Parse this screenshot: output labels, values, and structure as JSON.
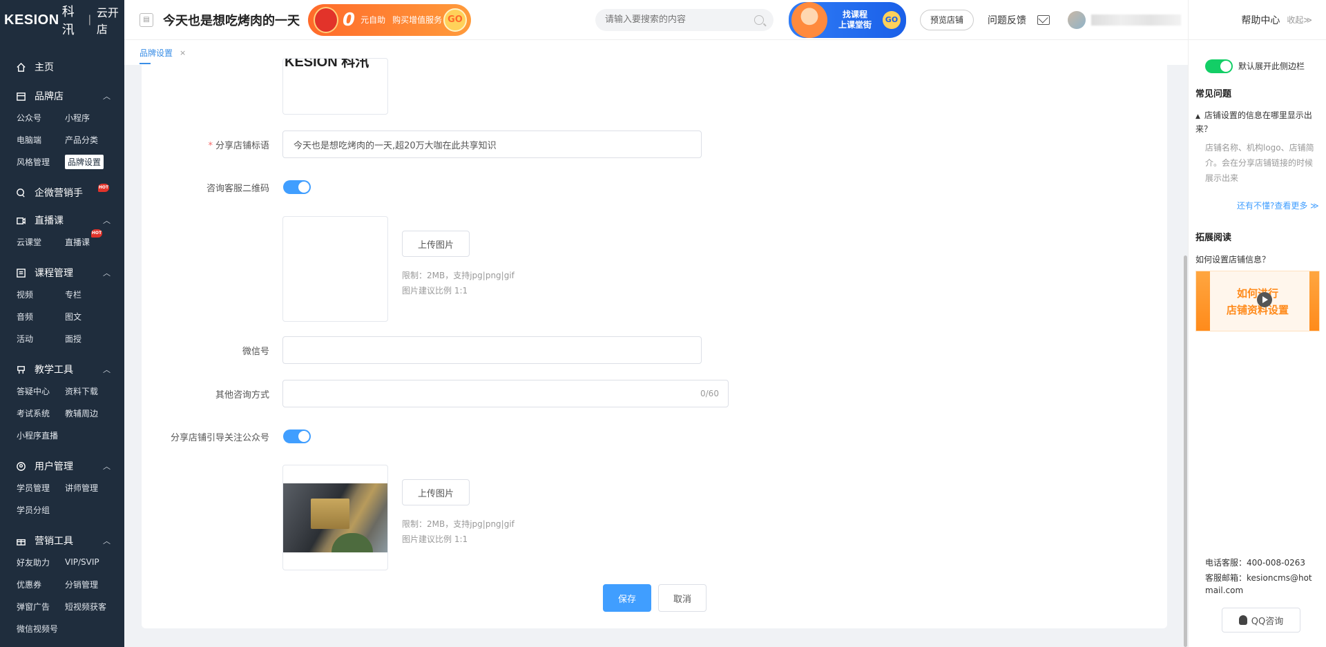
{
  "sidebar": {
    "brand": "KESION",
    "brand_cn": "科汛",
    "sep": "|",
    "sub": "云开店",
    "home": "主页",
    "groups": [
      {
        "label": "品牌店",
        "items": [
          "公众号",
          "小程序",
          "电脑端",
          "产品分类",
          "风格管理",
          "品牌设置"
        ]
      },
      {
        "label": "企微营销手",
        "hot": "HOT"
      },
      {
        "label": "直播课",
        "items": [
          "云课堂",
          "直播课"
        ],
        "hot": "HOT"
      },
      {
        "label": "课程管理",
        "items": [
          "视频",
          "专栏",
          "音频",
          "图文",
          "活动",
          "面授"
        ]
      },
      {
        "label": "教学工具",
        "items": [
          "答疑中心",
          "资料下载",
          "考试系统",
          "教辅周边",
          "小程序直播"
        ]
      },
      {
        "label": "用户管理",
        "items": [
          "学员管理",
          "讲师管理",
          "学员分组"
        ]
      },
      {
        "label": "营销工具",
        "items": [
          "好友助力",
          "VIP/SVIP",
          "优惠券",
          "分销管理",
          "弹窗广告",
          "短视频获客",
          "微信视频号"
        ]
      }
    ],
    "active_item": "品牌设置"
  },
  "topbar": {
    "store_name": "今天也是想吃烤肉的一天",
    "promo": {
      "zero": "0",
      "t1": "元自助",
      "t2": "购买增值服务",
      "go": "GO"
    },
    "search_placeholder": "请输入要搜索的内容",
    "banner2": {
      "line1": "找课程",
      "line2": "上课堂街",
      "go": "GO"
    },
    "preview": "预览店铺",
    "feedback": "问题反馈"
  },
  "tabs": [
    {
      "label": "品牌设置",
      "close": "×"
    }
  ],
  "form": {
    "share_title_label": "分享店铺标语",
    "share_title_value": "今天也是想吃烤肉的一天,超20万大咖在此共享知识",
    "qrcode_label": "咨询客服二维码",
    "upload_label": "上传图片",
    "hint_size": "限制：2MB，支持jpg|png|gif",
    "hint_ratio": "图片建议比例 1:1",
    "wechat_label": "微信号",
    "wechat_value": "",
    "other_label": "其他咨询方式",
    "other_value": "",
    "other_counter": "0/60",
    "follow_label": "分享店铺引导关注公众号",
    "logo_fragment": "KESION 科汛",
    "save": "保存",
    "cancel": "取消"
  },
  "help": {
    "title": "帮助中心",
    "collapse": "收起≫",
    "default_open": "默认展开此侧边栏",
    "faq_title": "常见问题",
    "faq_q": "店铺设置的信息在哪里显示出来？",
    "faq_a": "店铺名称、机构logo、店铺简介。会在分享店铺链接的时候展示出来",
    "more": "还有不懂?查看更多 ≫",
    "ext_title": "拓展阅读",
    "ext_q": "如何设置店铺信息？",
    "video_l1": "如何进行",
    "video_l2": "店铺资料设置",
    "phone": "电话客服：400-008-0263",
    "email": "客服邮箱：kesioncms@hotmail.com",
    "qq": "QQ咨询"
  },
  "colors": {
    "sidebar_bg": "#1f2d3d",
    "primary": "#409eff",
    "green": "#13ce66",
    "orange": "#ff8a1a"
  }
}
